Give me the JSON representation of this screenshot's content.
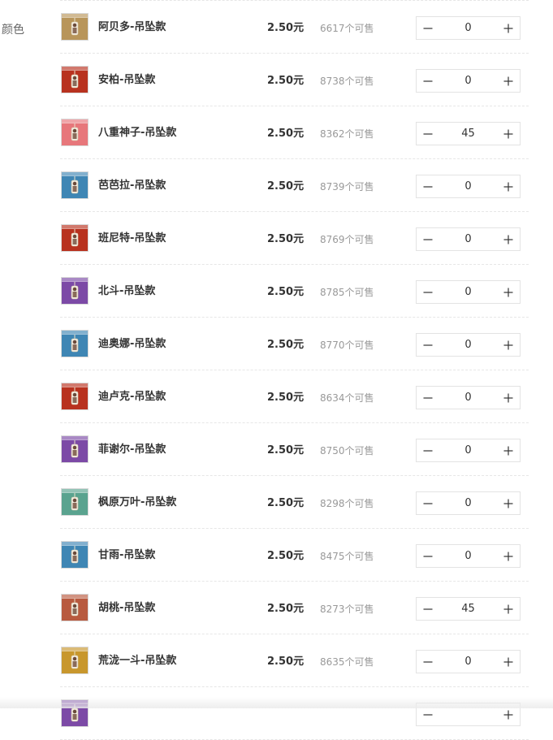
{
  "attribute": {
    "label": "颜色"
  },
  "items": [
    {
      "name": "阿贝多-吊坠款",
      "price": "2.50元",
      "stock": "6617个可售",
      "quantity": "0",
      "color": "#b8955a"
    },
    {
      "name": "安柏-吊坠款",
      "price": "2.50元",
      "stock": "8738个可售",
      "quantity": "0",
      "color": "#b8321f"
    },
    {
      "name": "八重神子-吊坠款",
      "price": "2.50元",
      "stock": "8362个可售",
      "quantity": "45",
      "color": "#e7777b"
    },
    {
      "name": "芭芭拉-吊坠款",
      "price": "2.50元",
      "stock": "8739个可售",
      "quantity": "0",
      "color": "#3f86b4"
    },
    {
      "name": "班尼特-吊坠款",
      "price": "2.50元",
      "stock": "8769个可售",
      "quantity": "0",
      "color": "#b8321f"
    },
    {
      "name": "北斗-吊坠款",
      "price": "2.50元",
      "stock": "8785个可售",
      "quantity": "0",
      "color": "#7c4aa6"
    },
    {
      "name": "迪奥娜-吊坠款",
      "price": "2.50元",
      "stock": "8770个可售",
      "quantity": "0",
      "color": "#3f86b4"
    },
    {
      "name": "迪卢克-吊坠款",
      "price": "2.50元",
      "stock": "8634个可售",
      "quantity": "0",
      "color": "#b8321f"
    },
    {
      "name": "菲谢尔-吊坠款",
      "price": "2.50元",
      "stock": "8750个可售",
      "quantity": "0",
      "color": "#7c4aa6"
    },
    {
      "name": "枫原万叶-吊坠款",
      "price": "2.50元",
      "stock": "8298个可售",
      "quantity": "0",
      "color": "#5aa38f"
    },
    {
      "name": "甘雨-吊坠款",
      "price": "2.50元",
      "stock": "8475个可售",
      "quantity": "0",
      "color": "#3f86b4"
    },
    {
      "name": "胡桃-吊坠款",
      "price": "2.50元",
      "stock": "8273个可售",
      "quantity": "45",
      "color": "#b85a3f"
    },
    {
      "name": "荒泷一斗-吊坠款",
      "price": "2.50元",
      "stock": "8635个可售",
      "quantity": "0",
      "color": "#c8972d"
    },
    {
      "name": "",
      "price": "",
      "stock": "",
      "quantity": "",
      "color": "#7c4aa6"
    }
  ],
  "icons": {
    "decrease": "minus-icon",
    "increase": "plus-icon"
  }
}
